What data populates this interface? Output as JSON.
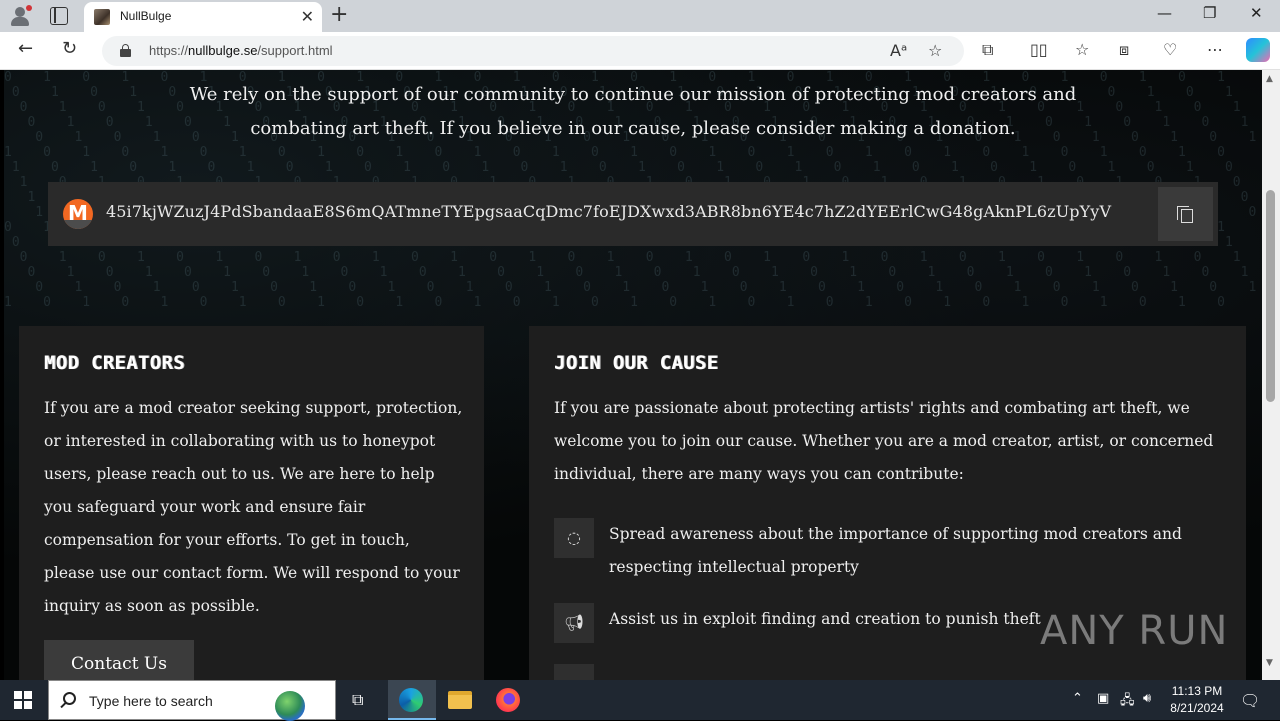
{
  "browser": {
    "tab_title": "NullBulge",
    "url_scheme": "https://",
    "url_host": "nullbulge.se",
    "url_path": "/support.html"
  },
  "page": {
    "intro_line1": "We rely on the support of our community to continue our mission of protecting mod creators and",
    "intro_line2": "combating art theft. If you believe in our cause, please consider making a donation.",
    "wallet": {
      "currency_icon": "monero-icon",
      "address": "45i7kjWZuzJ4PdSbandaaE8S6mQATmneTYEpgsaaCqDmc7foEJDXwxd3ABR8bn6YE4c7hZ2dYEErlCwG48gAknPL6zUpYyV"
    },
    "mod_creators": {
      "title": "MOD CREATORS",
      "text": "If you are a mod creator seeking support, protection, or interested in collaborating with us to honeypot users, please reach out to us. We are here to help you safeguard your work and ensure fair compensation for your efforts. To get in touch, please use our contact form. We will respond to your inquiry as soon as possible.",
      "button": "Contact Us"
    },
    "join_cause": {
      "title": "JOIN OUR CAUSE",
      "text": "If you are passionate about protecting artists' rights and combating art theft, we welcome you to join our cause. Whether you are a mod creator, artist, or concerned individual, there are many ways you can contribute:",
      "items": [
        {
          "icon": "spinner-icon",
          "text": "Spread awareness about the importance of supporting mod creators and respecting intellectual property"
        },
        {
          "icon": "megaphone-icon",
          "text": "Assist us in exploit finding and creation to punish theft"
        }
      ]
    },
    "watermark": "ANY RUN"
  },
  "taskbar": {
    "search_placeholder": "Type here to search",
    "time": "11:13 PM",
    "date": "8/21/2024"
  }
}
